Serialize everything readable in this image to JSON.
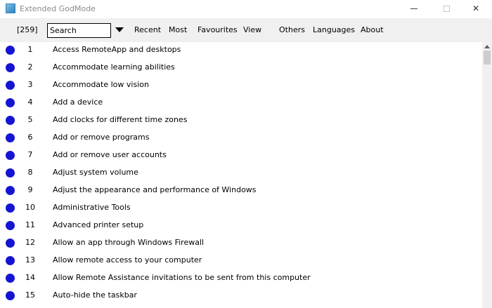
{
  "window": {
    "title": "Extended GodMode",
    "minimize_icon": "minimize-icon",
    "maximize_icon": "maximize-icon",
    "close_glyph": "✕"
  },
  "toolbar": {
    "count": "[259]",
    "search_value": "Search",
    "menu": [
      "Recent",
      "Most",
      "Favourites",
      "View",
      "Others",
      "Languages",
      "About"
    ]
  },
  "colors": {
    "bullet": "#1414d2",
    "toolbar_bg": "#f0f0f0"
  },
  "items": [
    {
      "num": "1",
      "label": "Access RemoteApp and desktops"
    },
    {
      "num": "2",
      "label": "Accommodate learning abilities"
    },
    {
      "num": "3",
      "label": "Accommodate low vision"
    },
    {
      "num": "4",
      "label": "Add a device"
    },
    {
      "num": "5",
      "label": "Add clocks for different time zones"
    },
    {
      "num": "6",
      "label": "Add or remove programs"
    },
    {
      "num": "7",
      "label": "Add or remove user accounts"
    },
    {
      "num": "8",
      "label": "Adjust system volume"
    },
    {
      "num": "9",
      "label": "Adjust the appearance and performance of Windows"
    },
    {
      "num": "10",
      "label": "Administrative Tools"
    },
    {
      "num": "11",
      "label": "Advanced printer setup"
    },
    {
      "num": "12",
      "label": "Allow an app through Windows Firewall"
    },
    {
      "num": "13",
      "label": "Allow remote access to your computer"
    },
    {
      "num": "14",
      "label": "Allow Remote Assistance invitations to be sent from this computer"
    },
    {
      "num": "15",
      "label": "Auto-hide the taskbar"
    }
  ]
}
